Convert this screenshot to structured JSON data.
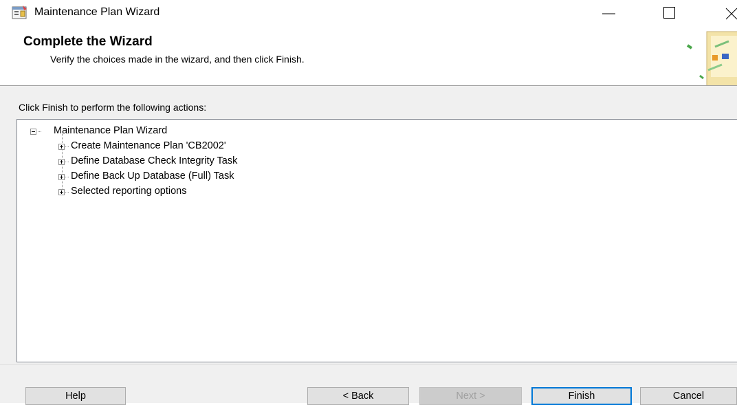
{
  "window": {
    "title": "Maintenance Plan Wizard",
    "icon": "wizard-app-icon",
    "controls": [
      "minimize-icon",
      "maximize-icon",
      "close-icon"
    ]
  },
  "header": {
    "title": "Complete the Wizard",
    "subtitle": "Verify the choices made in the wizard, and then click Finish."
  },
  "body": {
    "instruction": "Click Finish to perform the following actions:",
    "tree": {
      "root": {
        "label": "Maintenance Plan Wizard",
        "expanded": true
      },
      "children": [
        {
          "label": "Create Maintenance Plan 'CB2002'",
          "expanded": false
        },
        {
          "label": "Define Database Check Integrity Task",
          "expanded": false
        },
        {
          "label": "Define Back Up Database (Full) Task",
          "expanded": false
        },
        {
          "label": "Selected reporting options",
          "expanded": false
        }
      ]
    }
  },
  "footer": {
    "help_label": "Help",
    "back_label": "< Back",
    "next_label": "Next >",
    "finish_label": "Finish",
    "cancel_label": "Cancel"
  },
  "colors": {
    "panel_bg": "#f0f0f0",
    "default_button_border": "#0078d7",
    "disabled_text": "#a0a0a0"
  }
}
